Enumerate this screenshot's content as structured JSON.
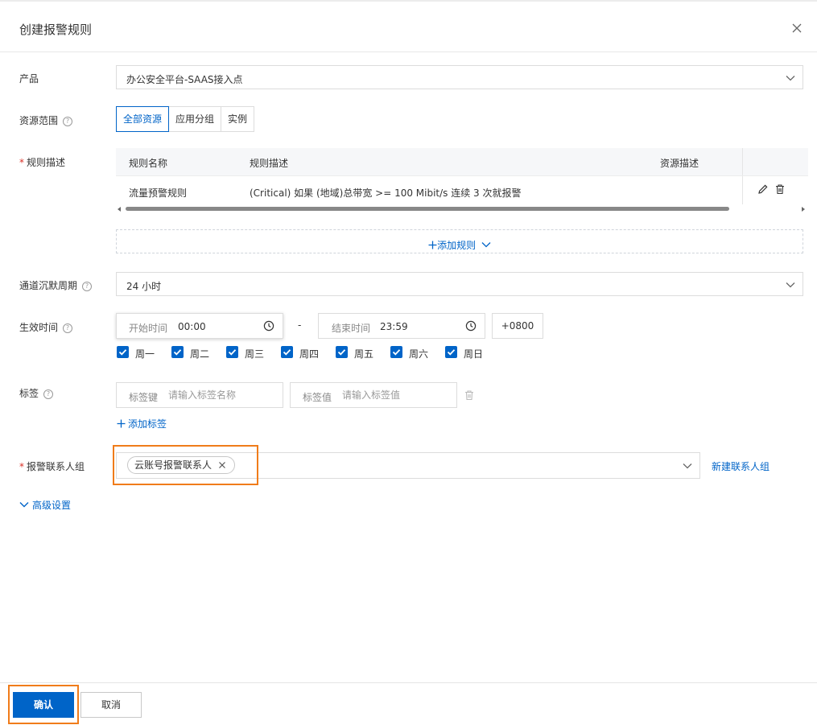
{
  "dialog": {
    "title": "创建报警规则"
  },
  "form": {
    "product": {
      "label": "产品",
      "value": "办公安全平台-SAAS接入点"
    },
    "scope": {
      "label": "资源范围",
      "options": [
        "全部资源",
        "应用分组",
        "实例"
      ],
      "selected": "全部资源"
    },
    "rules": {
      "label": "规则描述",
      "columns": [
        "规则名称",
        "规则描述",
        "资源描述"
      ],
      "rows": [
        {
          "name": "流量预警规则",
          "desc": "(Critical) 如果 (地域)总带宽 >= 100 Mibit/s 连续 3 次就报警",
          "resource": ""
        }
      ],
      "add_label": "添加规则"
    },
    "silence": {
      "label": "通道沉默周期",
      "value": "24 小时"
    },
    "effective": {
      "label": "生效时间",
      "start_label": "开始时间",
      "start_value": "00:00",
      "separator": "-",
      "end_label": "结束时间",
      "end_value": "23:59",
      "timezone": "+0800",
      "days": [
        "周一",
        "周二",
        "周三",
        "周四",
        "周五",
        "周六",
        "周日"
      ]
    },
    "tags": {
      "label": "标签",
      "key_label": "标签键",
      "key_placeholder": "请输入标签名称",
      "value_label": "标签值",
      "value_placeholder": "请输入标签值",
      "add_label": "添加标签"
    },
    "contacts": {
      "label": "报警联系人组",
      "chip": "云账号报警联系人",
      "new_label": "新建联系人组"
    },
    "advanced": {
      "label": "高级设置"
    }
  },
  "footer": {
    "confirm": "确认",
    "cancel": "取消"
  },
  "colors": {
    "accent": "#0064c8",
    "highlight": "#f07c1a",
    "required": "#d93026"
  }
}
